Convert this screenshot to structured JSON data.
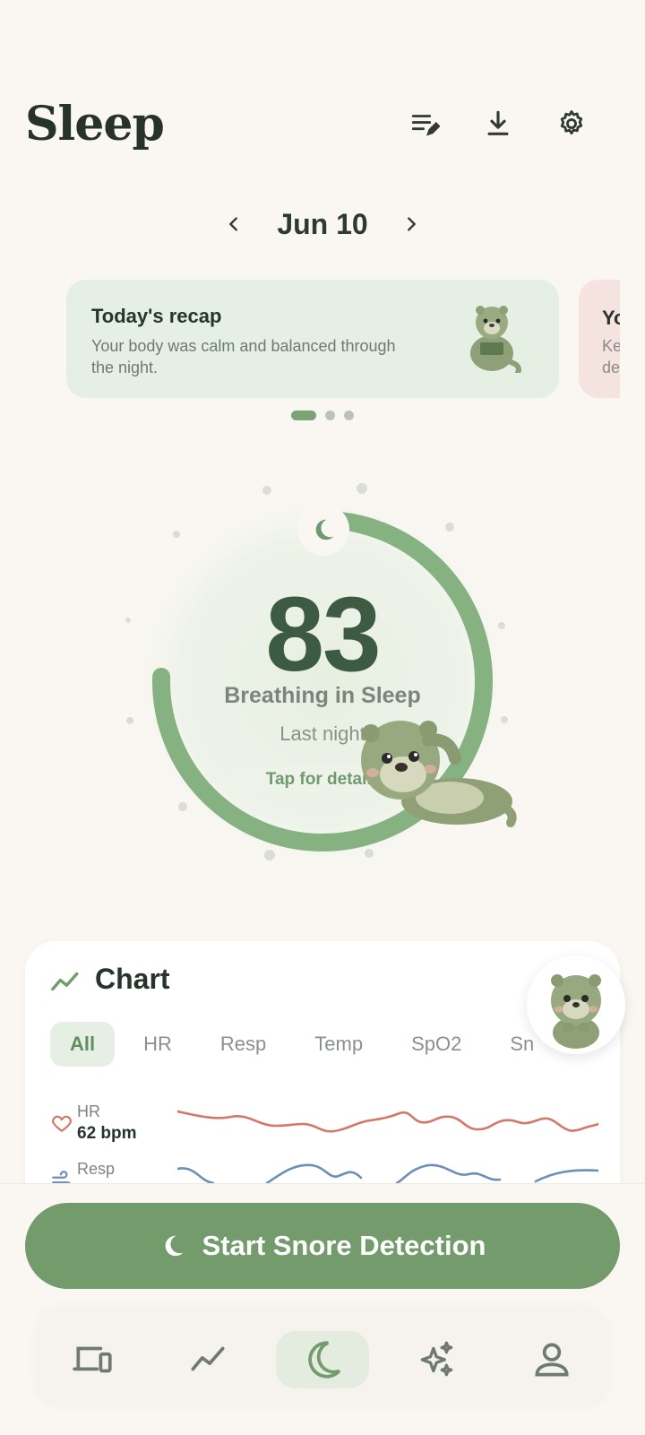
{
  "header": {
    "title": "Sleep",
    "icons": [
      "edit-list-icon",
      "download-icon",
      "settings-icon"
    ]
  },
  "date_nav": {
    "date": "Jun 10"
  },
  "recap_cards": [
    {
      "title": "Today's recap",
      "text": "Your body was calm and balanced through the night."
    },
    {
      "title": "Yo",
      "text_line1": "Ke",
      "text_line2": "de"
    }
  ],
  "carousel": {
    "active_index": 0,
    "count": 3
  },
  "score": {
    "value": "83",
    "label": "Breathing in Sleep",
    "sublabel": "Last night",
    "tap_hint": "Tap for details",
    "progress": 0.83
  },
  "chart": {
    "title": "Chart",
    "filters": [
      "All",
      "HR",
      "Resp",
      "Temp",
      "SpO2",
      "Sn"
    ],
    "active_filter": "All",
    "metrics": [
      {
        "name": "HR",
        "value": "62 bpm",
        "color": "#d4776a",
        "icon": "heart-icon"
      },
      {
        "name": "Resp",
        "value": "",
        "color": "#6b8fb5",
        "icon": "wind-icon"
      }
    ]
  },
  "cta": {
    "label": "Start Snore Detection"
  },
  "bottom_nav": {
    "items": [
      "devices",
      "trends",
      "sleep",
      "insights",
      "profile"
    ],
    "active": "sleep"
  },
  "colors": {
    "accent": "#739b6b",
    "ring": "#7fae7b",
    "background": "#faf7f2",
    "score_text": "#3d5a43"
  }
}
